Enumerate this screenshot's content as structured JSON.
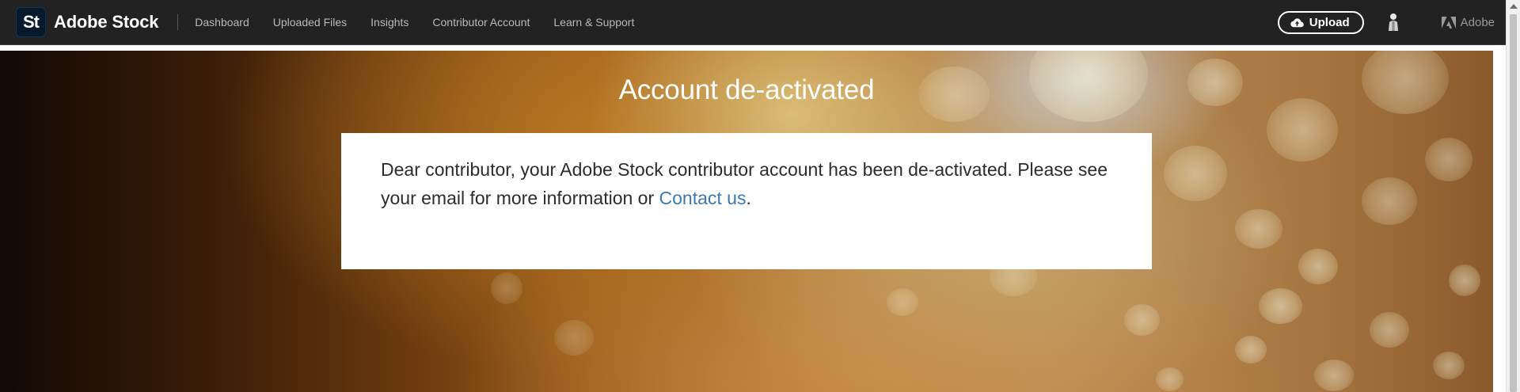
{
  "header": {
    "logo_mark": "St",
    "brand_name": "Adobe Stock",
    "nav": [
      {
        "label": "Dashboard"
      },
      {
        "label": "Uploaded Files"
      },
      {
        "label": "Insights"
      },
      {
        "label": "Contributor Account"
      },
      {
        "label": "Learn & Support"
      }
    ],
    "upload_label": "Upload",
    "upload_icon": "cloud-upload-icon",
    "avatar_icon": "user-avatar-icon",
    "adobe_label": "Adobe",
    "adobe_icon": "adobe-logo-icon"
  },
  "main": {
    "title": "Account de-activated",
    "message_text": "Dear contributor, your Adobe Stock contributor account has been de-activated. Please see your email for more information or ",
    "contact_link": "Contact us",
    "message_end": "."
  },
  "colors": {
    "topbar_bg": "#222222",
    "link": "#3b78b5",
    "hero_warm": "#b27a3c"
  }
}
